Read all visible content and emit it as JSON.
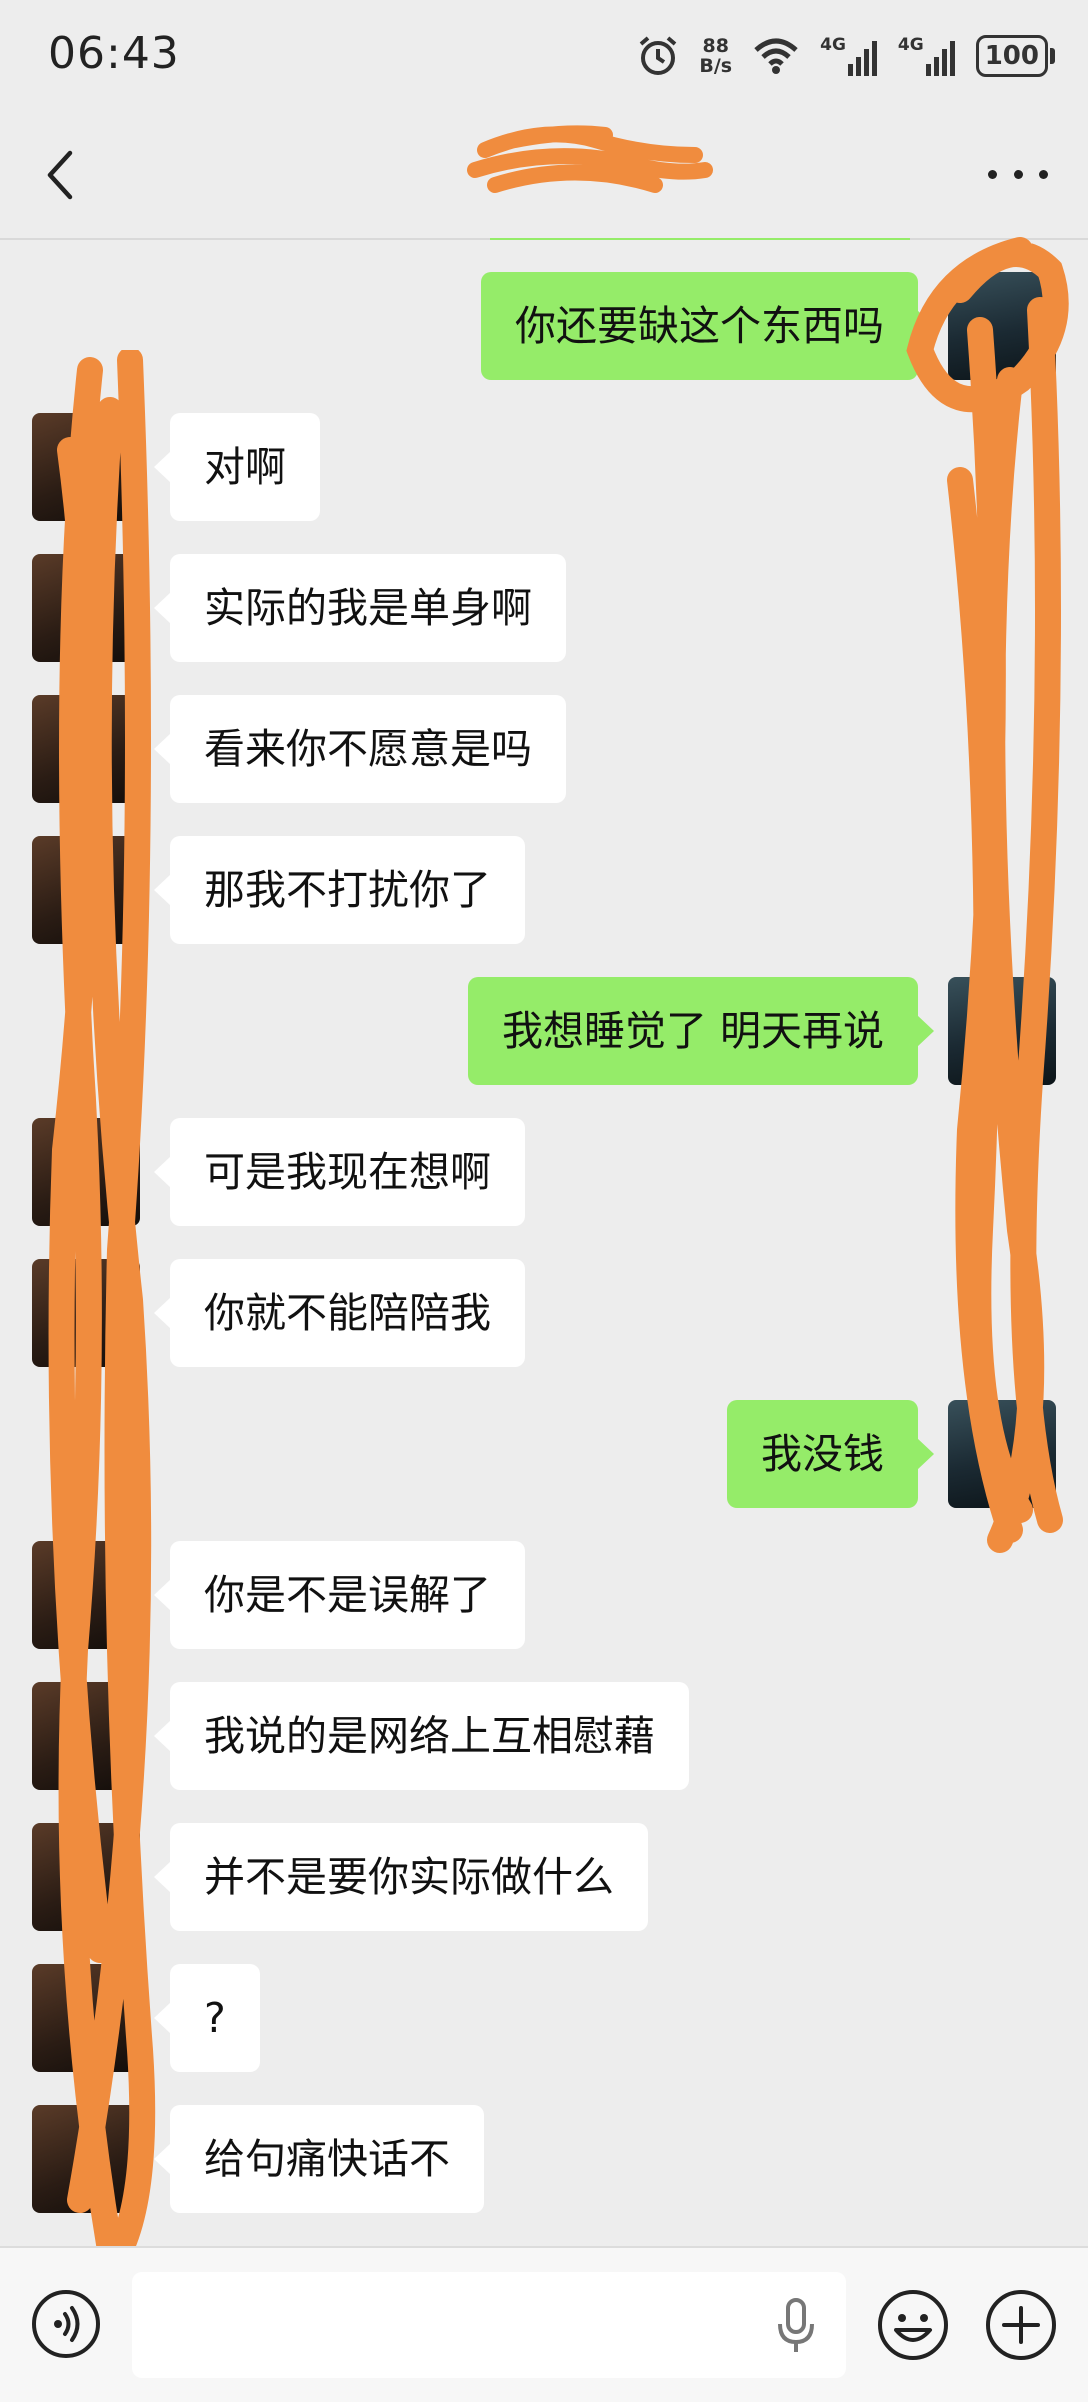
{
  "status_bar": {
    "time": "06:43",
    "net_speed_value": "88",
    "net_speed_unit": "B/s",
    "signal1_label": "4G",
    "signal2_label": "4G",
    "battery": "100"
  },
  "nav": {
    "title": ""
  },
  "messages": [
    {
      "side": "right",
      "text": "你还要缺这个东西吗"
    },
    {
      "side": "left",
      "text": "对啊"
    },
    {
      "side": "left",
      "text": "实际的我是单身啊"
    },
    {
      "side": "left",
      "text": "看来你不愿意是吗"
    },
    {
      "side": "left",
      "text": "那我不打扰你了"
    },
    {
      "side": "right",
      "text": "我想睡觉了 明天再说"
    },
    {
      "side": "left",
      "text": "可是我现在想啊"
    },
    {
      "side": "left",
      "text": "你就不能陪陪我"
    },
    {
      "side": "right",
      "text": "我没钱"
    },
    {
      "side": "left",
      "text": "你是不是误解了"
    },
    {
      "side": "left",
      "text": "我说的是网络上互相慰藉"
    },
    {
      "side": "left",
      "text": "并不是要你实际做什么"
    },
    {
      "side": "left",
      "text": "?"
    },
    {
      "side": "left",
      "text": "给句痛快话不"
    }
  ],
  "input_bar": {
    "value": "",
    "placeholder": ""
  },
  "colors": {
    "background": "#ededed",
    "sent_bubble": "#95ec69",
    "received_bubble": "#ffffff",
    "scribble": "#f08c3e"
  }
}
